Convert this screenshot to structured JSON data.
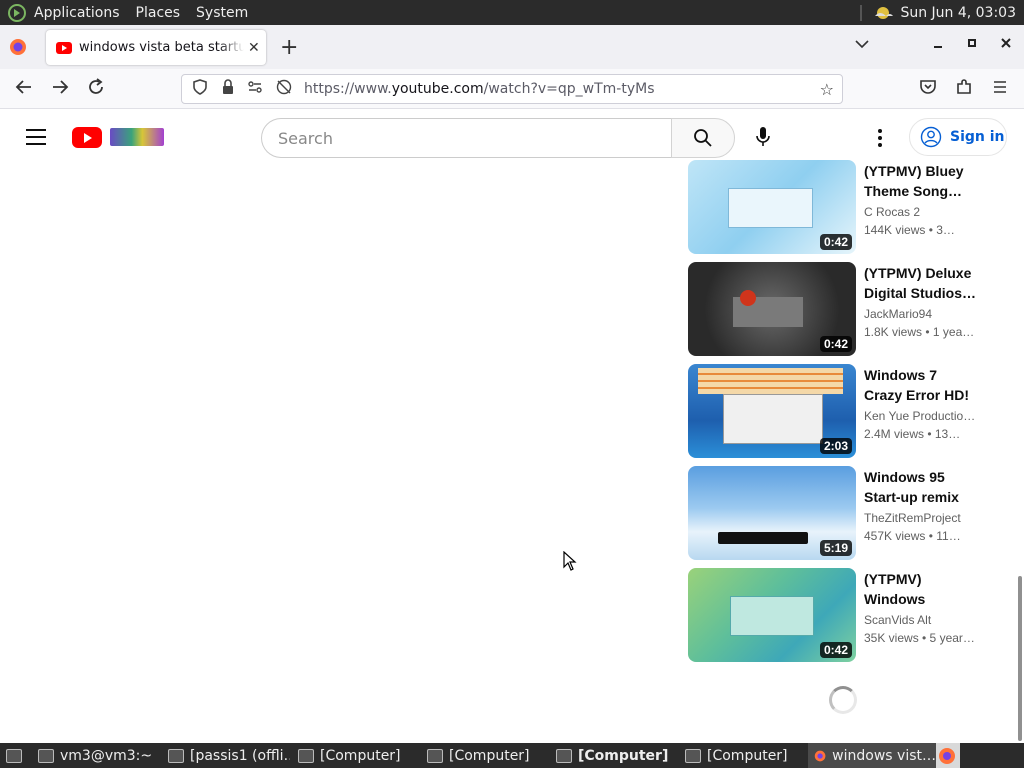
{
  "top_panel": {
    "menus": [
      "Applications",
      "Places",
      "System"
    ],
    "clock": "Sun Jun  4, 03:03"
  },
  "browser": {
    "tab_title": "windows vista beta startup s",
    "url_prefix": "https://www.",
    "url_host": "youtube.com",
    "url_path": "/watch?v=qp_wTm-tyMs"
  },
  "youtube": {
    "search_placeholder": "Search",
    "signin_label": "Sign in",
    "recommendations": [
      {
        "title": "(YTPMV) Bluey Theme Song…",
        "channel": "C Rocas 2",
        "stats": "144K views  • 3…",
        "duration": "0:42"
      },
      {
        "title": "(YTPMV) Deluxe Digital Studios…",
        "channel": "JackMario94",
        "stats": "1.8K views  • 1 yea…",
        "duration": "0:42"
      },
      {
        "title": "Windows 7 Crazy Error HD!",
        "channel": "Ken Yue Productio…",
        "stats": "2.4M views  • 13…",
        "duration": "2:03"
      },
      {
        "title": "Windows 95 Start-up remix",
        "channel": "TheZitRemProject",
        "stats": "457K views  • 11…",
        "duration": "5:19"
      },
      {
        "title": "(YTPMV) Windows Vista…",
        "channel": "ScanVids Alt",
        "stats": "35K views  • 5 year…",
        "duration": "0:42"
      }
    ]
  },
  "taskbar": {
    "items": [
      {
        "label": "vm3@vm3:~"
      },
      {
        "label": "[passis1 (offli…"
      },
      {
        "label": "[Computer]"
      },
      {
        "label": "[Computer]"
      },
      {
        "label": "[Computer]"
      },
      {
        "label": "[Computer]"
      },
      {
        "label": "windows vist…"
      }
    ]
  },
  "colors": {
    "yt_red": "#ff0000",
    "signin_blue": "#065fd4",
    "panel_bg": "#2b2b2b"
  }
}
